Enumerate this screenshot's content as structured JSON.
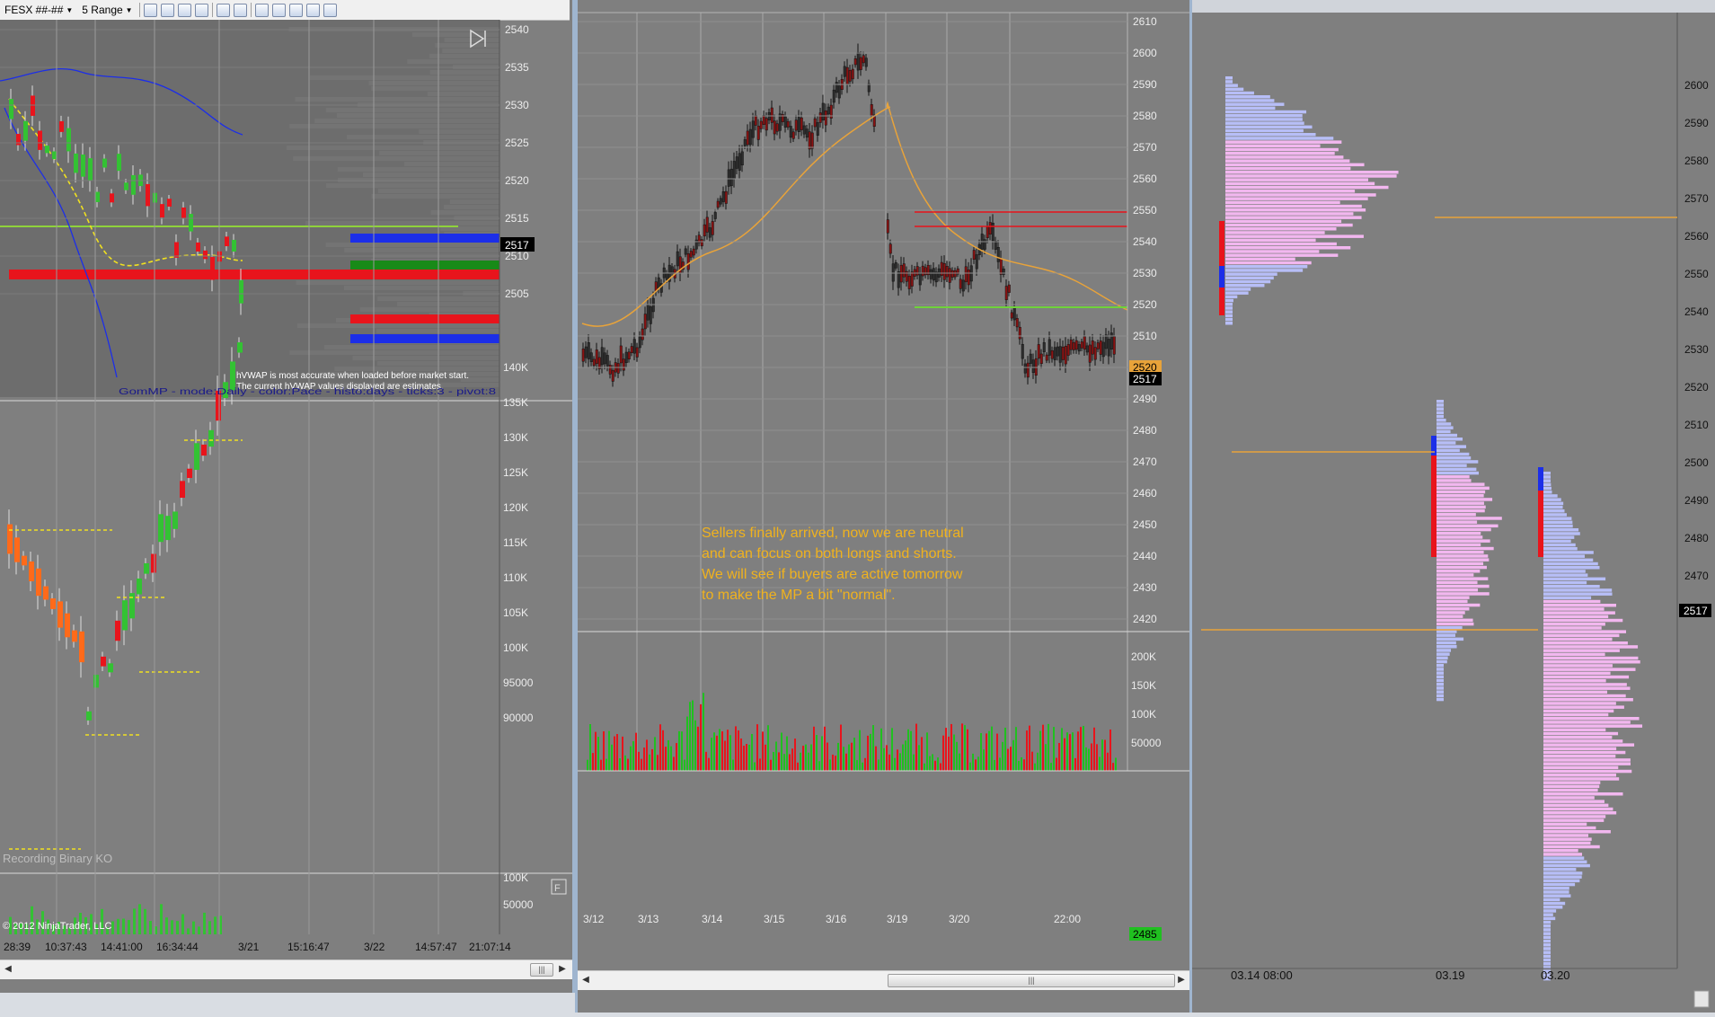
{
  "toolbar": {
    "instrument": "FESX ##-##",
    "period": "5 Range"
  },
  "left_chart": {
    "price_ticks": [
      "2540",
      "2535",
      "2530",
      "2525",
      "2520",
      "2515",
      "2510",
      "2505"
    ],
    "price_marker": "2517",
    "note_line1": "hVWAP is most accurate when loaded before market start.",
    "note_line2": "The current hVWAP values displayed are estimates.",
    "indicator_label": "GomMP - mode:Daily - color:Pace - histo:days - ticks:3 - pivot:8",
    "volume_ticks": [
      "140K",
      "135K",
      "130K",
      "125K",
      "120K",
      "115K",
      "110K",
      "105K",
      "100K",
      "95000",
      "90000"
    ],
    "recording_label": "Recording Binary KO",
    "lower_ticks": [
      "100K",
      "50000"
    ],
    "copyright": "© 2012 NinjaTrader, LLC",
    "time_labels": [
      "28:39",
      "10:37:43",
      "14:41:00",
      "16:34:44",
      "3/21",
      "15:16:47",
      "3/22",
      "14:57:47",
      "21:07:14"
    ]
  },
  "middle_chart": {
    "price_ticks": [
      "2610",
      "2600",
      "2590",
      "2580",
      "2570",
      "2560",
      "2550",
      "2540",
      "2530",
      "2520",
      "2510",
      "2500",
      "2490",
      "2480",
      "2470",
      "2460",
      "2450",
      "2440",
      "2430",
      "2420"
    ],
    "marker_orange": "2520",
    "marker_black": "2517",
    "volume_ticks": [
      "200K",
      "150K",
      "100K",
      "50000"
    ],
    "volume_marker": "2485",
    "date_labels": [
      "3/12",
      "3/13",
      "3/14",
      "3/15",
      "3/16",
      "3/19",
      "3/20",
      "22:00"
    ],
    "annotation": [
      "Sellers finally arrived, now we are neutral",
      "and can focus on both longs and shorts.",
      "We will see if buyers are active tomorrow",
      "to make the MP a bit \"normal\"."
    ]
  },
  "right_chart": {
    "price_ticks": [
      "2600",
      "2590",
      "2580",
      "2570",
      "2560",
      "2550",
      "2540",
      "2530",
      "2520",
      "2510",
      "2500",
      "2490",
      "2480",
      "2470"
    ],
    "price_marker": "2517",
    "date_labels": [
      "03.14 08:00",
      "03.19",
      "03.20"
    ]
  },
  "colors": {
    "chart_bg": "#7f7f7f",
    "profile_pink": "#f2b7ef",
    "profile_blue": "#b7bef7",
    "vwap_orange": "#e8a33a",
    "annotation_text": "#f0b21e",
    "poc_red": "#e8141c",
    "buy_green": "#20c020"
  }
}
